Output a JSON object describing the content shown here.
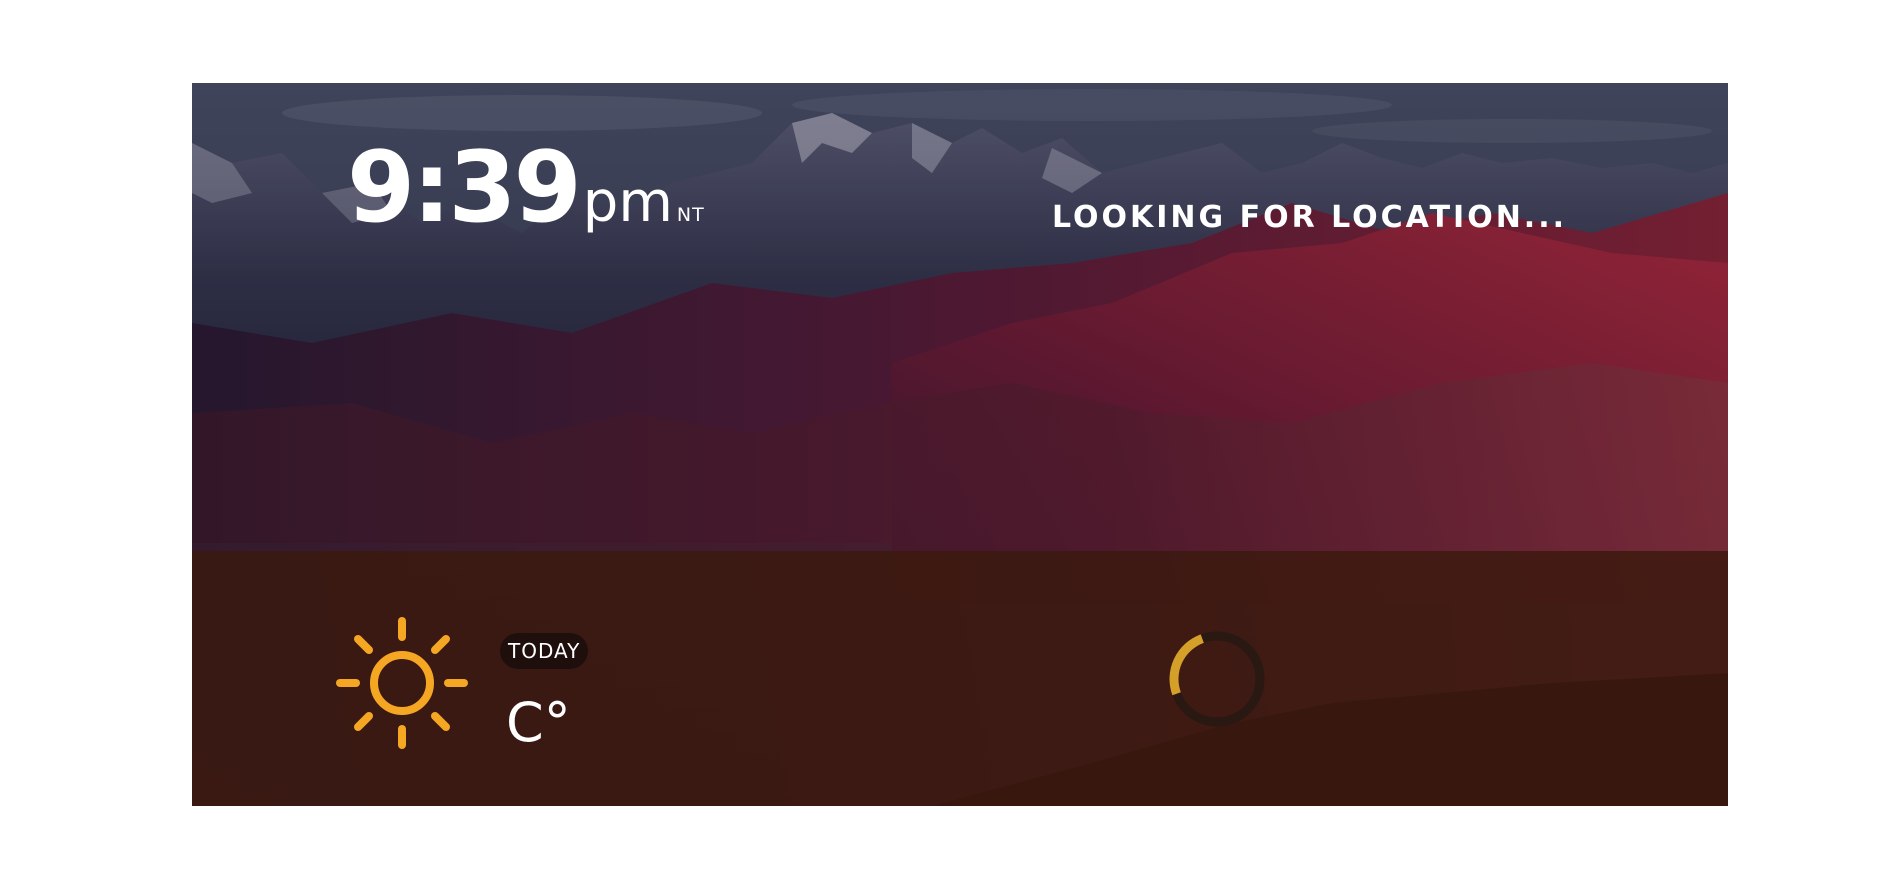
{
  "clock": {
    "time": "9:39",
    "ampm": "pm",
    "tz": "NT"
  },
  "location": {
    "status": "LOOKING FOR LOCATION..."
  },
  "weather": {
    "icon": "sun-icon",
    "day_label": "TODAY",
    "temperature": "C°"
  },
  "loader": {
    "icon": "loading-spinner",
    "progress": 0.25
  },
  "colors": {
    "sun": "#f5a623",
    "panel": "#3a1a0e",
    "spinner_accent": "#d4a02a",
    "spinner_track": "#2a1812"
  }
}
